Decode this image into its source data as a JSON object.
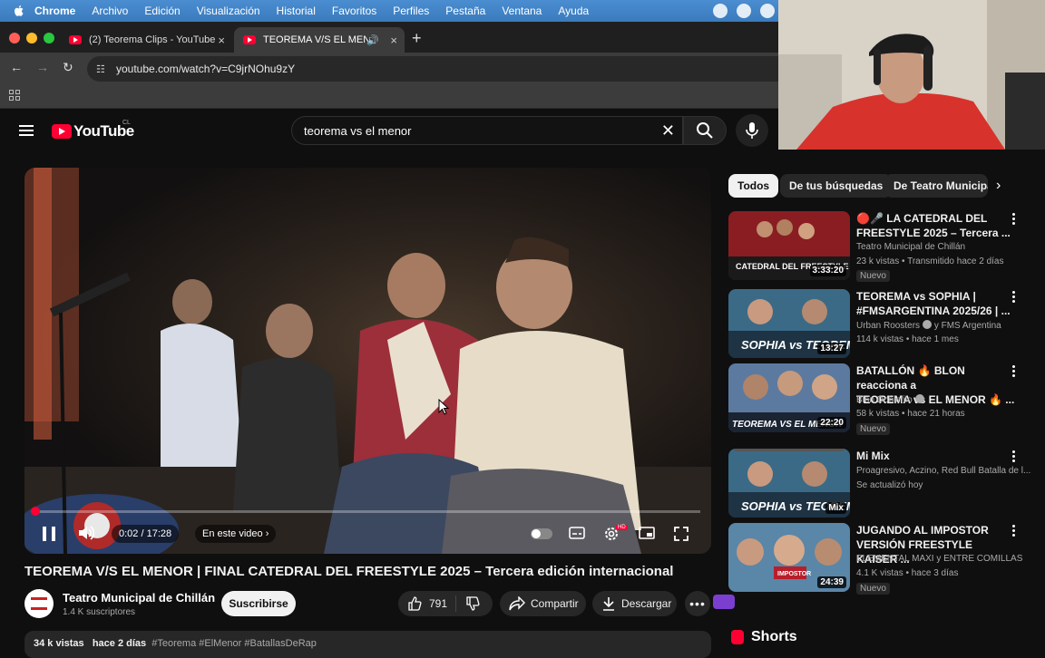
{
  "menubar": {
    "items": [
      "Chrome",
      "Archivo",
      "Edición",
      "Visualización",
      "Historial",
      "Favoritos",
      "Perfiles",
      "Pestaña",
      "Ventana",
      "Ayuda"
    ]
  },
  "tabs": [
    {
      "title": "(2) Teorema Clips - YouTube",
      "close": "×"
    },
    {
      "title": "TEOREMA V/S EL MENOR",
      "close": "×"
    }
  ],
  "toolbar": {
    "url": "youtube.com/watch?v=C9jrNOhu9zY"
  },
  "yt": {
    "logo_text": "YouTube",
    "region": "CL",
    "search_value": "teorema vs el menor",
    "clear_symbol": "✕"
  },
  "player": {
    "time": "0:02 / 17:28",
    "in_video": "En este video",
    "progress_fraction": 0.002
  },
  "video": {
    "title": "TEOREMA V/S EL MENOR | FINAL CATEDRAL DEL FREESTYLE 2025 – Tercera edición internacional",
    "channel": "Teatro Municipal de Chillán",
    "subscribers": "1.4 K suscriptores",
    "subscribe_label": "Suscribirse",
    "likes": "791",
    "share_label": "Compartir",
    "download_label": "Descargar",
    "views": "34 k vistas",
    "date": "hace 2 días",
    "tags": "#Teorema #ElMenor #BatallasDeRap"
  },
  "filters": {
    "chips": [
      "Todos",
      "De tus búsquedas",
      "De Teatro Municipa"
    ]
  },
  "recommendations": [
    {
      "title_l1": "🔴🎤 LA CATEDRAL DEL",
      "title_l2": "FREESTYLE 2025 – Tercera ...",
      "channel": "Teatro Municipal de Chillán",
      "meta": "23 k vistas • Transmitido hace 2 días",
      "duration": "3:33:20",
      "badge": "Nuevo"
    },
    {
      "title_l1": "TEOREMA vs SOPHIA |",
      "title_l2": "#FMSARGENTINA 2025/26 | ...",
      "channel": "Urban Roosters",
      "channel_suffix": "y FMS Argentina",
      "meta": "114 k vistas • hace 1 mes",
      "duration": "13:27"
    },
    {
      "title_l1": "BATALLÓN 🔥 BLON reacciona a",
      "title_l2": "TEOREMA vs EL MENOR 🔥 ...",
      "channel": "Blon Doblefilo",
      "meta": "58 k vistas • hace 21 horas",
      "duration": "22:20",
      "badge": "Nuevo"
    },
    {
      "title_l1": "Mi Mix",
      "title_l2": "",
      "channel": "Proagresivo, Aczino, Red Bull Batalla de l...",
      "meta": "Se actualizó hoy",
      "duration": "Mix"
    },
    {
      "title_l1": "JUGANDO AL IMPOSTOR",
      "title_l2": "VERSIÓN FREESTYLE KAISER ...",
      "channel": "ELEMENTAL MAXI y ENTRE COMILLAS",
      "meta": "4.1 K vistas • hace 3 días",
      "duration": "24:39",
      "badge": "Nuevo"
    }
  ],
  "thumb_text": {
    "t1": "CATEDRAL DEL FREESTYLE",
    "t2": "SOPHIA vs TEOREMA",
    "t3": "TEOREMA VS EL MENOR",
    "t5": "IMPOSTOR"
  },
  "shorts": {
    "label": "Shorts"
  },
  "colors": {
    "accent": "#ff0033",
    "bg": "#0f0f0f",
    "chip": "#272727"
  }
}
